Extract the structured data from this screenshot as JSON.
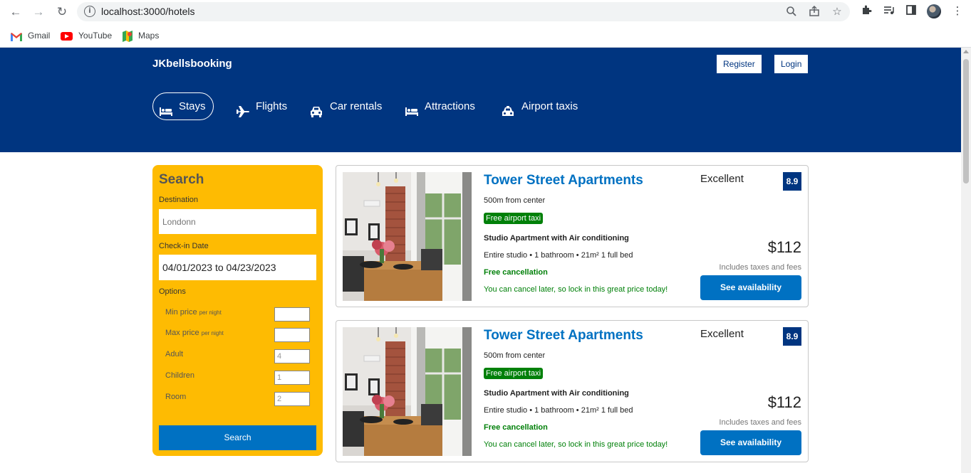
{
  "browser": {
    "url": "localhost:3000/hotels",
    "bookmarks": [
      {
        "label": "Gmail"
      },
      {
        "label": "YouTube"
      },
      {
        "label": "Maps"
      }
    ]
  },
  "header": {
    "logo": "JKbellsbooking",
    "register_label": "Register",
    "login_label": "Login",
    "nav": [
      {
        "label": "Stays",
        "icon": "bed-icon",
        "active": true
      },
      {
        "label": "Flights",
        "icon": "plane-icon"
      },
      {
        "label": "Car rentals",
        "icon": "car-icon"
      },
      {
        "label": "Attractions",
        "icon": "bed-icon"
      },
      {
        "label": "Airport taxis",
        "icon": "taxi-icon"
      }
    ]
  },
  "search": {
    "title": "Search",
    "destination_label": "Destination",
    "destination_placeholder": "Londonn",
    "checkin_label": "Check-in Date",
    "checkin_value": "04/01/2023 to 04/23/2023",
    "options_label": "Options",
    "options": [
      {
        "label": "Min price",
        "suffix": "per night",
        "value": ""
      },
      {
        "label": "Max price",
        "suffix": "per night",
        "value": ""
      },
      {
        "label": "Adult",
        "suffix": "",
        "value": "4"
      },
      {
        "label": "Children",
        "suffix": "",
        "value": "1"
      },
      {
        "label": "Room",
        "suffix": "",
        "value": "2"
      }
    ],
    "button_label": "Search"
  },
  "results": [
    {
      "name": "Tower Street Apartments",
      "distance": "500m from center",
      "taxi_badge": "Free airport taxi",
      "subtitle": "Studio Apartment with Air conditioning",
      "features": "Entire studio • 1 bathroom • 21m² 1 full bed",
      "cancel": "Free cancellation",
      "cancel_sub": "You can cancel later, so lock in this great price today!",
      "rating_text": "Excellent",
      "rating": "8.9",
      "price": "$112",
      "tax_note": "Includes taxes and fees",
      "button_label": "See availability"
    },
    {
      "name": "Tower Street Apartments",
      "distance": "500m from center",
      "taxi_badge": "Free airport taxi",
      "subtitle": "Studio Apartment with Air conditioning",
      "features": "Entire studio • 1 bathroom • 21m² 1 full bed",
      "cancel": "Free cancellation",
      "cancel_sub": "You can cancel later, so lock in this great price today!",
      "rating_text": "Excellent",
      "rating": "8.9",
      "price": "$112",
      "tax_note": "Includes taxes and fees",
      "button_label": "See availability"
    }
  ]
}
